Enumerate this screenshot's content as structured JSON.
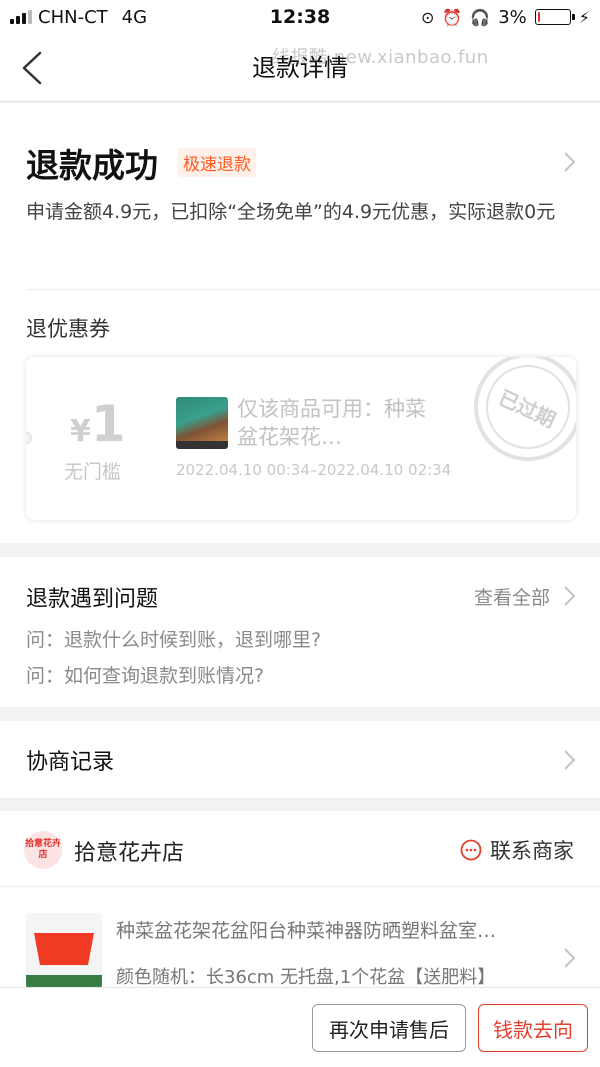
{
  "status_bar": {
    "carrier": "CHN-CT",
    "network": "4G",
    "time": "12:38",
    "battery_percent": "3%",
    "battery_level": 0.03,
    "battery_color": "#e6333a",
    "icons": [
      "rotation-lock-icon",
      "alarm-icon",
      "headphones-icon",
      "charging-bolt-icon"
    ]
  },
  "nav": {
    "title": "退款详情",
    "watermark": "线报酷 new.xianbao.fun"
  },
  "refund_status": {
    "title": "退款成功",
    "badge": "极速退款",
    "description": "申请金额4.9元，已扣除“全场免单”的4.9元优惠，实际退款0元"
  },
  "coupon_section": {
    "title": "退优惠券",
    "coupon": {
      "currency": "¥",
      "amount": "1",
      "threshold": "无门槛",
      "name": "仅该商品可用：种菜盆花架花…",
      "validity": "2022.04.10 00:34–2022.04.10 02:34",
      "stamp": "已过期"
    }
  },
  "faq": {
    "title": "退款遇到问题",
    "view_all": "查看全部",
    "items": [
      "问：退款什么时候到账，退到哪里?",
      "问：如何查询退款到账情况?"
    ]
  },
  "negotiation": {
    "title": "协商记录"
  },
  "shop": {
    "logo_text": "拾意花卉店",
    "name": "拾意花卉店",
    "contact_label": "联系商家",
    "product": {
      "title": "种菜盆花架花盆阳台种菜神器防晒塑料盆室…",
      "spec": "颜色随机：长36cm 无托盘,1个花盆【送肥料】"
    }
  },
  "actions": {
    "reapply": "再次申请售后",
    "refund_flow": "钱款去向"
  },
  "colors": {
    "accent": "#e33f2f",
    "badge_text": "#ff5a1f",
    "badge_bg": "#fff1ea"
  }
}
